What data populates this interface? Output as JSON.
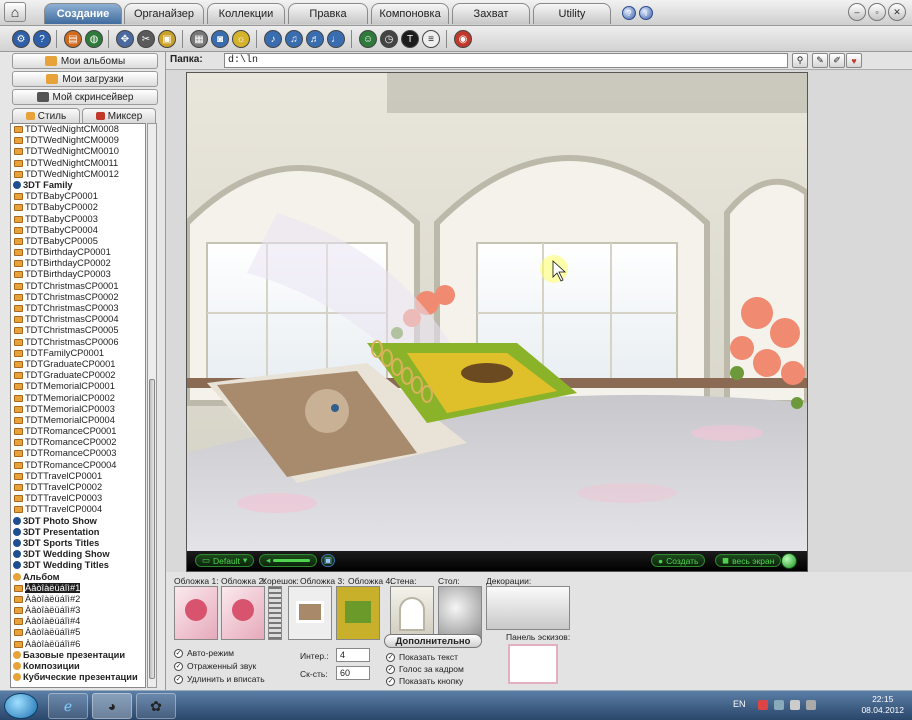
{
  "tabs": [
    {
      "label": "Создание",
      "active": true
    },
    {
      "label": "Органайзер"
    },
    {
      "label": "Коллекции"
    },
    {
      "label": "Правка"
    },
    {
      "label": "Компоновка"
    },
    {
      "label": "Захват"
    },
    {
      "label": "Utility"
    }
  ],
  "left_nav": {
    "my_albums": "Мои альбомы",
    "my_downloads": "Мои загрузки",
    "my_screensaver": "Мой скринсейвер",
    "tab_style": "Стиль",
    "tab_mixer": "Миксер"
  },
  "tree": [
    {
      "label": "TDTWedNightCM0008",
      "type": "item"
    },
    {
      "label": "TDTWedNightCM0009",
      "type": "item"
    },
    {
      "label": "TDTWedNightCM0010",
      "type": "item"
    },
    {
      "label": "TDTWedNightCM0011",
      "type": "item"
    },
    {
      "label": "TDTWedNightCM0012",
      "type": "item"
    },
    {
      "label": "3DT Family",
      "type": "cat"
    },
    {
      "label": "TDTBabyCP0001",
      "type": "item"
    },
    {
      "label": "TDTBabyCP0002",
      "type": "item"
    },
    {
      "label": "TDTBabyCP0003",
      "type": "item"
    },
    {
      "label": "TDTBabyCP0004",
      "type": "item"
    },
    {
      "label": "TDTBabyCP0005",
      "type": "item"
    },
    {
      "label": "TDTBirthdayCP0001",
      "type": "item"
    },
    {
      "label": "TDTBirthdayCP0002",
      "type": "item"
    },
    {
      "label": "TDTBirthdayCP0003",
      "type": "item"
    },
    {
      "label": "TDTChristmasCP0001",
      "type": "item"
    },
    {
      "label": "TDTChristmasCP0002",
      "type": "item"
    },
    {
      "label": "TDTChristmasCP0003",
      "type": "item"
    },
    {
      "label": "TDTChristmasCP0004",
      "type": "item"
    },
    {
      "label": "TDTChristmasCP0005",
      "type": "item"
    },
    {
      "label": "TDTChristmasCP0006",
      "type": "item"
    },
    {
      "label": "TDTFamilyCP0001",
      "type": "item"
    },
    {
      "label": "TDTGraduateCP0001",
      "type": "item"
    },
    {
      "label": "TDTGraduateCP0002",
      "type": "item"
    },
    {
      "label": "TDTMemorialCP0001",
      "type": "item"
    },
    {
      "label": "TDTMemorialCP0002",
      "type": "item"
    },
    {
      "label": "TDTMemorialCP0003",
      "type": "item"
    },
    {
      "label": "TDTMemorialCP0004",
      "type": "item"
    },
    {
      "label": "TDTRomanceCP0001",
      "type": "item"
    },
    {
      "label": "TDTRomanceCP0002",
      "type": "item"
    },
    {
      "label": "TDTRomanceCP0003",
      "type": "item"
    },
    {
      "label": "TDTRomanceCP0004",
      "type": "item"
    },
    {
      "label": "TDTTravelCP0001",
      "type": "item"
    },
    {
      "label": "TDTTravelCP0002",
      "type": "item"
    },
    {
      "label": "TDTTravelCP0003",
      "type": "item"
    },
    {
      "label": "TDTTravelCP0004",
      "type": "item"
    },
    {
      "label": "3DT Photo Show",
      "type": "cat"
    },
    {
      "label": "3DT Presentation",
      "type": "cat"
    },
    {
      "label": "3DT Sports Titles",
      "type": "cat"
    },
    {
      "label": "3DT Wedding Show",
      "type": "cat"
    },
    {
      "label": "3DT Wedding Titles",
      "type": "cat"
    },
    {
      "label": "Альбом",
      "type": "folder"
    },
    {
      "label": "Àâòîàëüáîì#1",
      "type": "item",
      "selected": true
    },
    {
      "label": "Àâòîàëüáîì#2",
      "type": "item"
    },
    {
      "label": "Àâòîàëüáîì#3",
      "type": "item"
    },
    {
      "label": "Àâòîàëüáîì#4",
      "type": "item"
    },
    {
      "label": "Àâòîàëüáîì#5",
      "type": "item"
    },
    {
      "label": "Àâòîàëüáîì#6",
      "type": "item"
    },
    {
      "label": "Базовые презентации",
      "type": "folder"
    },
    {
      "label": "Композиции",
      "type": "folder"
    },
    {
      "label": "Кубические презентации",
      "type": "folder"
    }
  ],
  "path": {
    "label": "Папка:",
    "value": "d:\\ln"
  },
  "preview_controls": {
    "preset": "Default",
    "create": "Создать",
    "full_screen": "весь экран"
  },
  "bottom": {
    "cover1": "Обложка 1:",
    "cover2": "Обложка 2:",
    "spine": "Корешок:",
    "cover3": "Обложка 3:",
    "cover4": "Обложка 4:",
    "wall": "Стена:",
    "table": "Стол:",
    "decor": "Декорации:",
    "sketch_panel": "Панель эскизов:",
    "auto_mode": "Авто-режим",
    "reflected_sound": "Отраженный звук",
    "stretch_fit": "Удлинить и вписать",
    "interval_label": "Интер.:",
    "interval_value": "4",
    "speed_label": "Ск-сть:",
    "speed_value": "60",
    "advanced_button": "Дополнительно",
    "show_text": "Показать текст",
    "voice_over": "Голос за кадром",
    "show_button": "Показать кнопку"
  },
  "taskbar": {
    "lang": "EN",
    "time": "22:15",
    "date": "08.04.2012"
  }
}
